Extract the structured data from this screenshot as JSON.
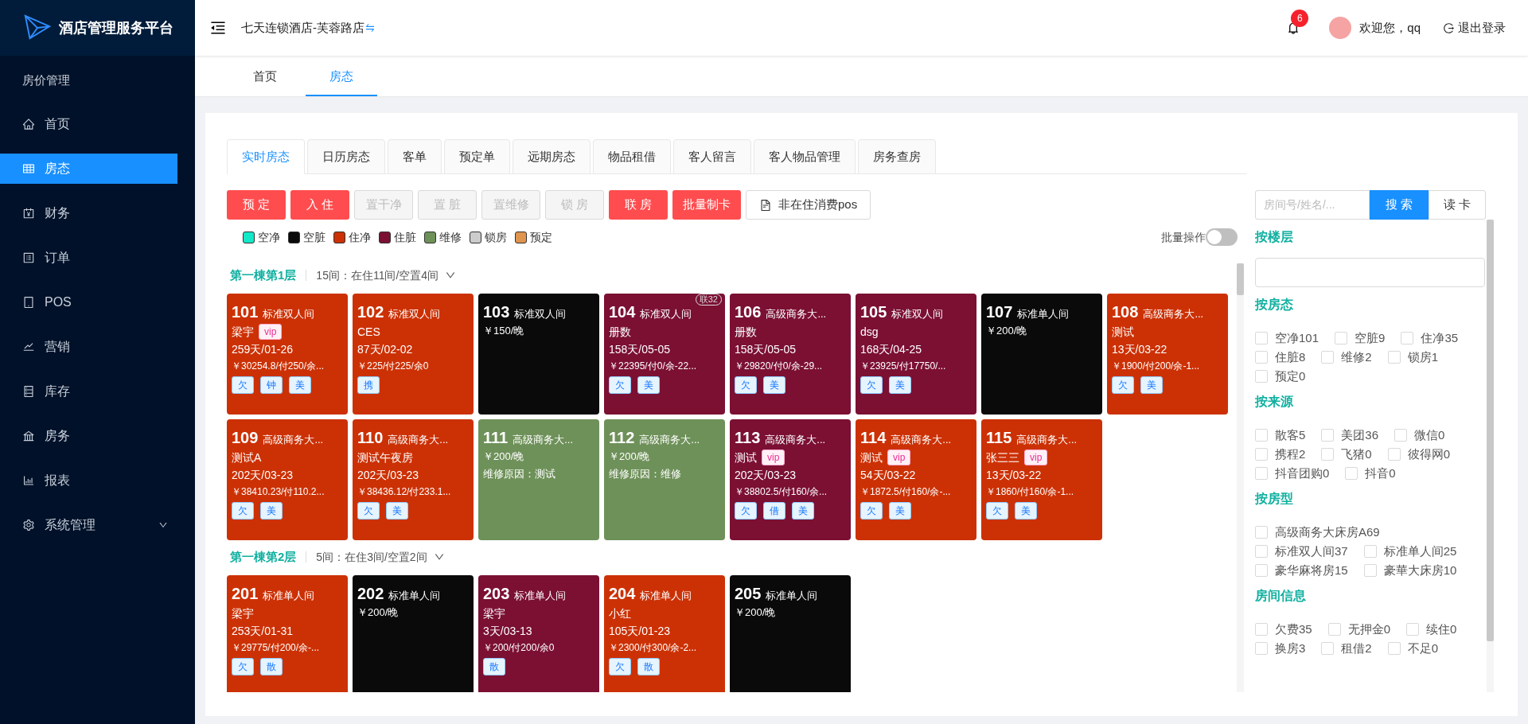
{
  "sidebar": {
    "brand": "酒店管理服务平台",
    "group_title": "房价管理",
    "items": [
      {
        "label": "首页",
        "selected": false,
        "kind": "item"
      },
      {
        "label": "房态",
        "selected": true,
        "kind": "item"
      },
      {
        "label": "财务",
        "selected": false,
        "kind": "item"
      },
      {
        "label": "订单",
        "selected": false,
        "kind": "item"
      },
      {
        "label": "POS",
        "selected": false,
        "kind": "item"
      },
      {
        "label": "营销",
        "selected": false,
        "kind": "item"
      },
      {
        "label": "库存",
        "selected": false,
        "kind": "item"
      },
      {
        "label": "房务",
        "selected": false,
        "kind": "item"
      },
      {
        "label": "报表",
        "selected": false,
        "kind": "item"
      },
      {
        "label": "系统管理",
        "selected": false,
        "kind": "submenu"
      }
    ]
  },
  "header": {
    "hotel": "七天连锁酒店-芙蓉路店",
    "notifications": "6",
    "welcome": "欢迎您，qq",
    "logout": "退出登录"
  },
  "page_tabs": [
    {
      "label": "首页",
      "selected": false
    },
    {
      "label": "房态",
      "selected": true
    }
  ],
  "tabs": [
    {
      "label": "实时房态",
      "selected": true
    },
    {
      "label": "日历房态",
      "selected": false
    },
    {
      "label": "客单",
      "selected": false
    },
    {
      "label": "预定单",
      "selected": false
    },
    {
      "label": "远期房态",
      "selected": false
    },
    {
      "label": "物品租借",
      "selected": false
    },
    {
      "label": "客人留言",
      "selected": false
    },
    {
      "label": "客人物品管理",
      "selected": false
    },
    {
      "label": "房务查房",
      "selected": false
    }
  ],
  "actions": [
    {
      "label": "预 定",
      "kind": "primary",
      "disabled": false
    },
    {
      "label": "入 住",
      "kind": "primary",
      "disabled": false
    },
    {
      "label": "置干净",
      "kind": "primary",
      "disabled": true
    },
    {
      "label": "置 脏",
      "kind": "primary",
      "disabled": true
    },
    {
      "label": "置维修",
      "kind": "primary",
      "disabled": true
    },
    {
      "label": "锁 房",
      "kind": "primary",
      "disabled": true
    },
    {
      "label": "联 房",
      "kind": "primary",
      "disabled": false
    },
    {
      "label": "批量制卡",
      "kind": "primary",
      "disabled": false
    },
    {
      "label": "非在住消费pos",
      "kind": "outline",
      "disabled": false
    }
  ],
  "legend": [
    {
      "label": "空净",
      "color": "#13e8c8"
    },
    {
      "label": "空脏",
      "color": "#0a0a0a"
    },
    {
      "label": "住净",
      "color": "#cc3105"
    },
    {
      "label": "住脏",
      "color": "#7b1033"
    },
    {
      "label": "维修",
      "color": "#6e9159"
    },
    {
      "label": "锁房",
      "color": "#cccccc"
    },
    {
      "label": "预定",
      "color": "#e0954f"
    }
  ],
  "batch": {
    "label": "批量操作",
    "on": false
  },
  "floors": [
    {
      "title": "第一棟第1层",
      "summary": "15间：在住11间/空置4间",
      "rooms": [
        {
          "number": "101",
          "type": "标准双人间",
          "color": "#cc3105",
          "guest": "梁宇",
          "vip_label": "vip",
          "stay": "259天/01-26",
          "amount": "￥30254.8/付250/余...",
          "tags": [
            "欠",
            "钟",
            "美"
          ]
        },
        {
          "number": "102",
          "type": "标准双人间",
          "color": "#cc3105",
          "guest": "CES",
          "stay": "87天/02-02",
          "amount": "￥225/付225/余0",
          "tags": [
            "携"
          ]
        },
        {
          "number": "103",
          "type": "标准双人间",
          "color": "#0a0a0a",
          "price": "￥150/晚"
        },
        {
          "number": "104",
          "type": "标准双人间",
          "color": "#7b1033",
          "guest": "册数",
          "stay": "158天/05-05",
          "amount": "￥22395/付0/余-22...",
          "tags": [
            "欠",
            "美"
          ],
          "link_badge": "联32"
        },
        {
          "number": "106",
          "type": "高级商务大...",
          "color": "#7b1033",
          "guest": "册数",
          "stay": "158天/05-05",
          "amount": "￥29820/付0/余-29...",
          "tags": [
            "欠",
            "美"
          ]
        },
        {
          "number": "105",
          "type": "标准双人间",
          "color": "#7b1033",
          "guest": "dsg",
          "stay": "168天/04-25",
          "amount": "￥23925/付17750/...",
          "tags": [
            "欠",
            "美"
          ]
        },
        {
          "number": "107",
          "type": "标准单人间",
          "color": "#0a0a0a",
          "price": "￥200/晚"
        },
        {
          "number": "108",
          "type": "高级商务大...",
          "color": "#cc3105",
          "guest": "测试",
          "stay": "13天/03-22",
          "amount": "￥1900/付200/余-1...",
          "tags": [
            "欠",
            "美"
          ]
        },
        {
          "number": "109",
          "type": "高级商务大...",
          "color": "#cc3105",
          "guest": "测试A",
          "stay": "202天/03-23",
          "amount": "￥38410.23/付110.2...",
          "tags": [
            "欠",
            "美"
          ]
        },
        {
          "number": "110",
          "type": "高级商务大...",
          "color": "#cc3105",
          "guest": "测试午夜房",
          "stay": "202天/03-23",
          "amount": "￥38436.12/付233.1...",
          "tags": [
            "欠",
            "美"
          ]
        },
        {
          "number": "111",
          "type": "高级商务大...",
          "color": "#6e9159",
          "price": "￥200/晚",
          "note": "维修原因：测试"
        },
        {
          "number": "112",
          "type": "高级商务大...",
          "color": "#6e9159",
          "price": "￥200/晚",
          "note": "维修原因：维修"
        },
        {
          "number": "113",
          "type": "高级商务大...",
          "color": "#7b1033",
          "guest": "测试",
          "vip_label": "vip",
          "stay": "202天/03-23",
          "amount": "￥38802.5/付160/余...",
          "tags": [
            "欠",
            "借",
            "美"
          ]
        },
        {
          "number": "114",
          "type": "高级商务大...",
          "color": "#cc3105",
          "guest": "测试",
          "vip_label": "vip",
          "stay": "54天/03-22",
          "amount": "￥1872.5/付160/余-...",
          "tags": [
            "欠",
            "美"
          ]
        },
        {
          "number": "115",
          "type": "高级商务大...",
          "color": "#cc3105",
          "guest": "张三三",
          "vip_label": "vip",
          "stay": "13天/03-22",
          "amount": "￥1860/付160/余-1...",
          "tags": [
            "欠",
            "美"
          ]
        }
      ]
    },
    {
      "title": "第一棟第2层",
      "summary": "5间：在住3间/空置2间",
      "rooms": [
        {
          "number": "201",
          "type": "标准单人间",
          "color": "#cc3105",
          "guest": "梁宇",
          "stay": "253天/01-31",
          "amount": "￥29775/付200/余-...",
          "tags": [
            "欠",
            "散"
          ]
        },
        {
          "number": "202",
          "type": "标准单人间",
          "color": "#0a0a0a",
          "price": "￥200/晚"
        },
        {
          "number": "203",
          "type": "标准单人间",
          "color": "#7b1033",
          "guest": "梁宇",
          "stay": "3天/03-13",
          "amount": "￥200/付200/余0",
          "tags": [
            "散"
          ]
        },
        {
          "number": "204",
          "type": "标准单人间",
          "color": "#cc3105",
          "guest": "小红",
          "stay": "105天/01-23",
          "amount": "￥2300/付300/余-2...",
          "tags": [
            "欠",
            "散"
          ]
        },
        {
          "number": "205",
          "type": "标准单人间",
          "color": "#0a0a0a",
          "price": "￥200/晚"
        }
      ]
    }
  ],
  "search": {
    "placeholder": "房间号/姓名/...",
    "button": "搜 索",
    "read_card": "读 卡"
  },
  "filters": [
    {
      "title": "按楼层",
      "kind": "select"
    },
    {
      "title": "按房态",
      "kind": "checks",
      "options": [
        {
          "label": "空净101",
          "checked": false
        },
        {
          "label": "空脏9",
          "checked": false
        },
        {
          "label": "住净35",
          "checked": false
        },
        {
          "label": "住脏8",
          "checked": false
        },
        {
          "label": "维修2",
          "checked": false
        },
        {
          "label": "锁房1",
          "checked": false
        },
        {
          "label": "预定0",
          "checked": false
        }
      ]
    },
    {
      "title": "按来源",
      "kind": "checks",
      "options": [
        {
          "label": "散客5",
          "checked": false
        },
        {
          "label": "美团36",
          "checked": false
        },
        {
          "label": "微信0",
          "checked": false
        },
        {
          "label": "携程2",
          "checked": false
        },
        {
          "label": "飞猪0",
          "checked": false
        },
        {
          "label": "彼得网0",
          "checked": false
        },
        {
          "label": "抖音团购0",
          "checked": false
        },
        {
          "label": "抖音0",
          "checked": false
        }
      ]
    },
    {
      "title": "按房型",
      "kind": "checks",
      "options": [
        {
          "label": "高级商务大床房A69",
          "checked": false
        },
        {
          "label": "标准双人间37",
          "checked": false
        },
        {
          "label": "标准单人间25",
          "checked": false
        },
        {
          "label": "豪华麻将房15",
          "checked": false
        },
        {
          "label": "豪華大床房10",
          "checked": false
        }
      ]
    },
    {
      "title": "房间信息",
      "kind": "checks",
      "options": [
        {
          "label": "欠费35",
          "checked": false
        },
        {
          "label": "无押金0",
          "checked": false
        },
        {
          "label": "续住0",
          "checked": false
        },
        {
          "label": "换房3",
          "checked": false
        },
        {
          "label": "租借2",
          "checked": false
        },
        {
          "label": "不足0",
          "checked": false
        }
      ]
    }
  ]
}
